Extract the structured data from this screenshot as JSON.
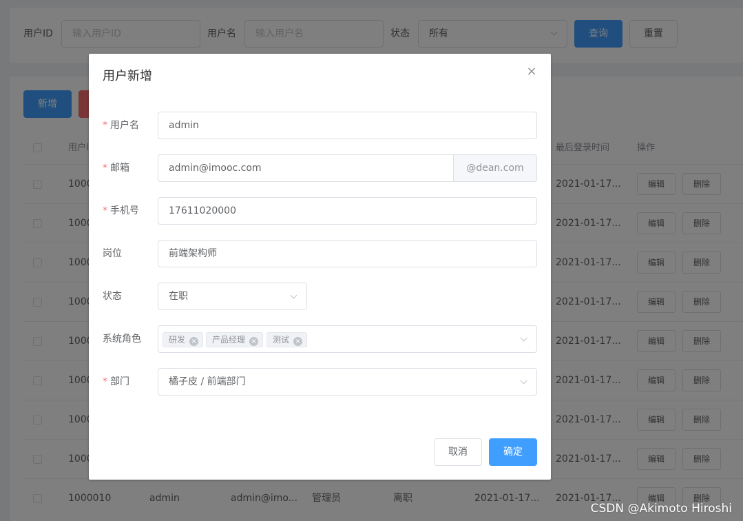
{
  "search": {
    "user_id_label": "用户ID",
    "user_id_placeholder": "输入用户ID",
    "username_label": "用户名",
    "username_placeholder": "输入用户名",
    "status_label": "状态",
    "status_value": "所有",
    "query_label": "查询",
    "reset_label": "重置"
  },
  "actions": {
    "add_label": "新增"
  },
  "table": {
    "headers": {
      "user_id": "用户I",
      "last_login": "最后登录时间",
      "operation": "操作"
    },
    "rows": [
      {
        "id": "1000",
        "last_login": "2021-01-17..."
      },
      {
        "id": "1000",
        "last_login": "2021-01-17..."
      },
      {
        "id": "1000",
        "last_login": "2021-01-17..."
      },
      {
        "id": "1000",
        "last_login": "2021-01-17..."
      },
      {
        "id": "1000",
        "last_login": "2021-01-17..."
      },
      {
        "id": "1000",
        "last_login": "2021-01-17..."
      },
      {
        "id": "1000",
        "last_login": "2021-01-17..."
      },
      {
        "id": "1000",
        "last_login": "2021-01-17..."
      }
    ],
    "last_row": {
      "id": "1000010",
      "username": "admin",
      "email": "admin@imo...",
      "role": "管理员",
      "state": "离职",
      "create_time": "2021-01-17...",
      "last_login": "2021-01-17..."
    },
    "edit_label": "编辑",
    "delete_label": "删除"
  },
  "dialog": {
    "title": "用户新增",
    "close_glyph": "×",
    "fields": {
      "username": {
        "label": "用户名",
        "value": "admin"
      },
      "email": {
        "label": "邮箱",
        "value": "admin@imooc.com",
        "suffix": "@dean.com"
      },
      "mobile": {
        "label": "手机号",
        "value": "17611020000"
      },
      "job": {
        "label": "岗位",
        "value": "前端架构师"
      },
      "state": {
        "label": "状态",
        "value": "在职"
      },
      "roles": {
        "label": "系统角色",
        "tags": [
          "研发",
          "产品经理",
          "测试"
        ]
      },
      "dept": {
        "label": "部门",
        "value": "橘子皮 / 前端部门"
      }
    },
    "cancel_label": "取消",
    "confirm_label": "确定"
  },
  "watermark": "CSDN @Akimoto Hiroshi",
  "colors": {
    "primary": "#409eff",
    "danger": "#f56c6c",
    "required": "#f56c6c",
    "overlay": "rgba(0,0,0,0.5)"
  }
}
